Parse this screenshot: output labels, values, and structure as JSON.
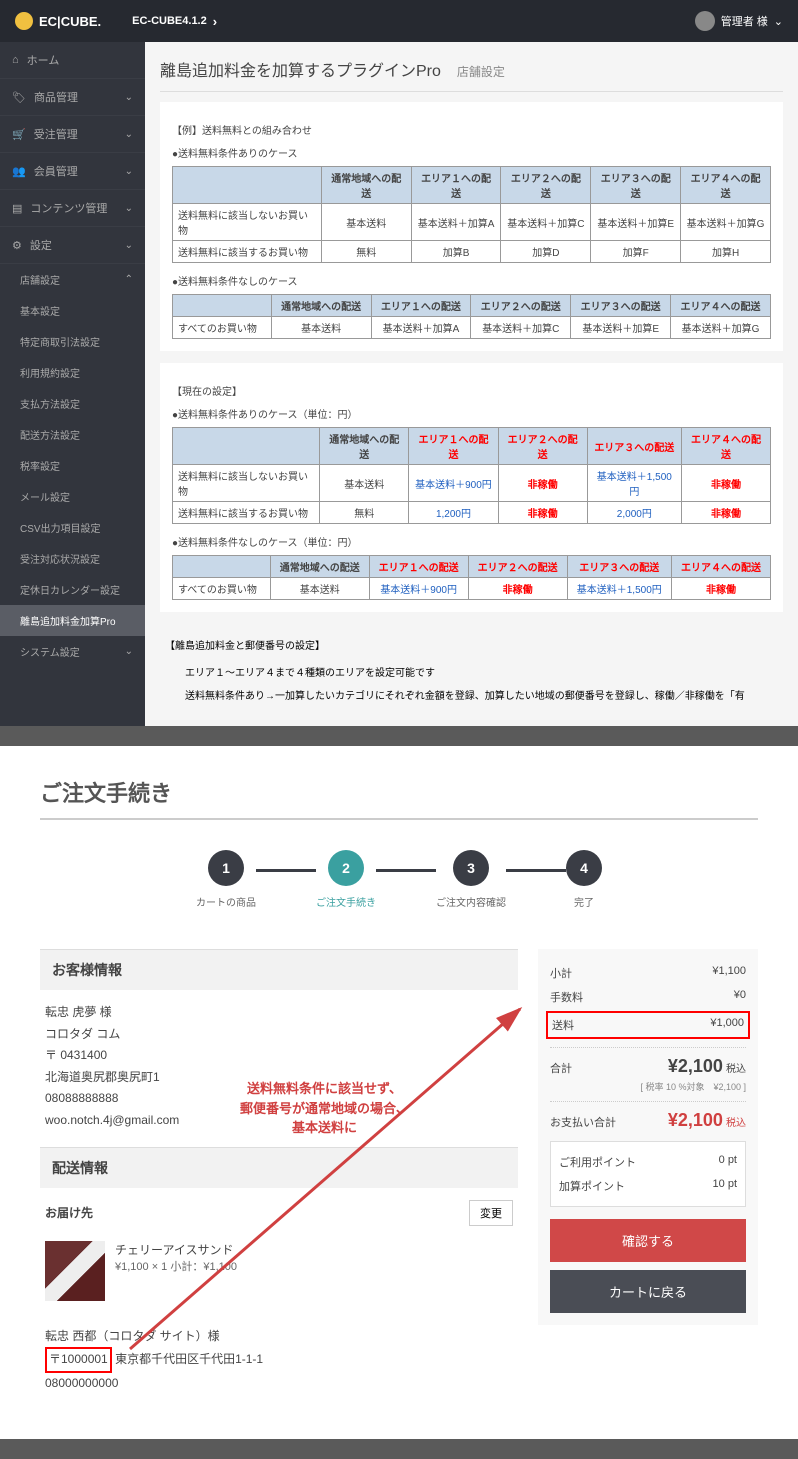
{
  "topbar": {
    "brand": "EC|CUBE.",
    "version": "EC-CUBE4.1.2",
    "user": "管理者 様"
  },
  "sidebar": {
    "items": [
      {
        "label": "ホーム",
        "icon": "home"
      },
      {
        "label": "商品管理",
        "icon": "tag"
      },
      {
        "label": "受注管理",
        "icon": "cart"
      },
      {
        "label": "会員管理",
        "icon": "users"
      },
      {
        "label": "コンテンツ管理",
        "icon": "doc"
      },
      {
        "label": "設定",
        "icon": "gear"
      }
    ],
    "sub_header": "店舗設定",
    "subs": [
      "基本設定",
      "特定商取引法設定",
      "利用規約設定",
      "支払方法設定",
      "配送方法設定",
      "税率設定",
      "メール設定",
      "CSV出力項目設定",
      "受注対応状況設定",
      "定休日カレンダー設定"
    ],
    "active": "離島追加料金加算Pro",
    "footer": "システム設定"
  },
  "page": {
    "title": "離島追加料金を加算するプラグインPro",
    "sub": "店舗設定"
  },
  "card1": {
    "heading": "【例】送料無料との組み合わせ",
    "b1": "●送料無料条件ありのケース",
    "headers": [
      "",
      "通常地域への配送",
      "エリア１への配送",
      "エリア２への配送",
      "エリア３への配送",
      "エリア４への配送"
    ],
    "r1": [
      "送料無料に該当しないお買い物",
      "基本送料",
      "基本送料＋加算A",
      "基本送料＋加算C",
      "基本送料＋加算E",
      "基本送料＋加算G"
    ],
    "r2": [
      "送料無料に該当するお買い物",
      "無料",
      "加算B",
      "加算D",
      "加算F",
      "加算H"
    ],
    "b2": "●送料無料条件なしのケース",
    "r3": [
      "すべてのお買い物",
      "基本送料",
      "基本送料＋加算A",
      "基本送料＋加算C",
      "基本送料＋加算E",
      "基本送料＋加算G"
    ]
  },
  "card2": {
    "heading": "【現在の設定】",
    "b1": "●送料無料条件ありのケース（単位：円）",
    "headers": [
      "",
      "通常地域への配送",
      "エリア１への配送",
      "エリア２への配送",
      "エリア３への配送",
      "エリア４への配送"
    ],
    "r1": [
      "送料無料に該当しないお買い物",
      "基本送料",
      "基本送料＋900円",
      "非稼働",
      "基本送料＋1,500円",
      "非稼働"
    ],
    "r2": [
      "送料無料に該当するお買い物",
      "無料",
      "1,200円",
      "非稼働",
      "2,000円",
      "非稼働"
    ],
    "b2": "●送料無料条件なしのケース（単位：円）",
    "r3": [
      "すべてのお買い物",
      "基本送料",
      "基本送料＋900円",
      "非稼働",
      "基本送料＋1,500円",
      "非稼働"
    ]
  },
  "card3": {
    "heading": "【離島追加料金と郵便番号の設定】",
    "l1": "エリア１～エリア４まで４種類のエリアを設定可能です",
    "l2": "送料無料条件あり→一加算したいカテゴリにそれぞれ金額を登録、加算したい地域の郵便番号を登録し、稼働／非稼働を「有"
  },
  "order": {
    "title": "ご注文手続き",
    "steps": [
      "カートの商品",
      "ご注文手続き",
      "ご注文内容確認",
      "完了"
    ],
    "cust_h": "お客様情報",
    "cust": [
      "転忠 虎夢 様",
      "コロタダ コム",
      "〒 0431400",
      "北海道奥尻郡奥尻町1",
      "08088888888",
      "woo.notch.4j@gmail.com"
    ],
    "ship_h": "配送情報",
    "deliv_h": "お届け先",
    "change": "変更",
    "prod_name": "チェリーアイスサンド",
    "prod_price": "¥1,100 × 1  小計：¥1,100",
    "addr_name": "転忠 西都（コロタダ サイト）様",
    "addr_zip": "〒1000001",
    "addr_rest": "東京都千代田区千代田1-1-1",
    "addr_tel": "08000000000",
    "sum": {
      "subtotal_l": "小計",
      "subtotal_v": "¥1,100",
      "fee_l": "手数料",
      "fee_v": "¥0",
      "ship_l": "送料",
      "ship_v": "¥1,000",
      "total_l": "合計",
      "total_v": "¥2,100",
      "total_tax": "税込",
      "tax_note": "[ 税率 10 %対象　¥2,100 ]",
      "pay_l": "お支払い合計",
      "pay_v": "¥2,100",
      "pay_tax": "税込",
      "pt1_l": "ご利用ポイント",
      "pt1_v": "0 pt",
      "pt2_l": "加算ポイント",
      "pt2_v": "10 pt",
      "confirm": "確認する",
      "back": "カートに戻る"
    },
    "annotation": "送料無料条件に該当せず、\n郵便番号が通常地域の場合、\n基本送料に"
  }
}
